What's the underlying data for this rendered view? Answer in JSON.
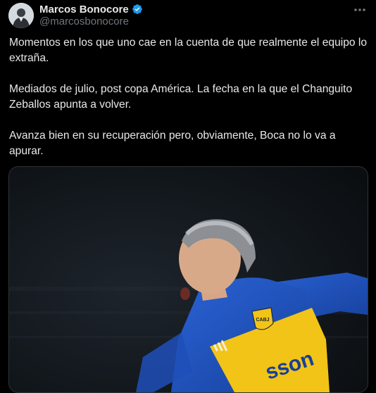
{
  "author": {
    "name": "Marcos Bonocore",
    "handle": "@marcosbonocore",
    "verified_icon": "verified-badge-icon",
    "avatar_icon": "user-avatar"
  },
  "menu_icon": "more-icon",
  "tweet": {
    "paragraphs": [
      "Momentos en los que uno cae en la cuenta de que realmente el equipo lo extraña.",
      "Mediados de julio, post copa América. La fecha en la que el Changuito Zeballos apunta a volver.",
      "Avanza bien en su recuperación pero, obviamente, Boca no lo va a apurar."
    ]
  },
  "media": {
    "jersey_crest": "CABJ",
    "jersey_sponsor": "sson",
    "colors": {
      "blue": "#1f4fb8",
      "yellow": "#f2c418"
    }
  },
  "colors": {
    "background": "#000000",
    "text": "#e7e9ea",
    "secondary": "#71767b",
    "verified": "#1d9bf0"
  }
}
